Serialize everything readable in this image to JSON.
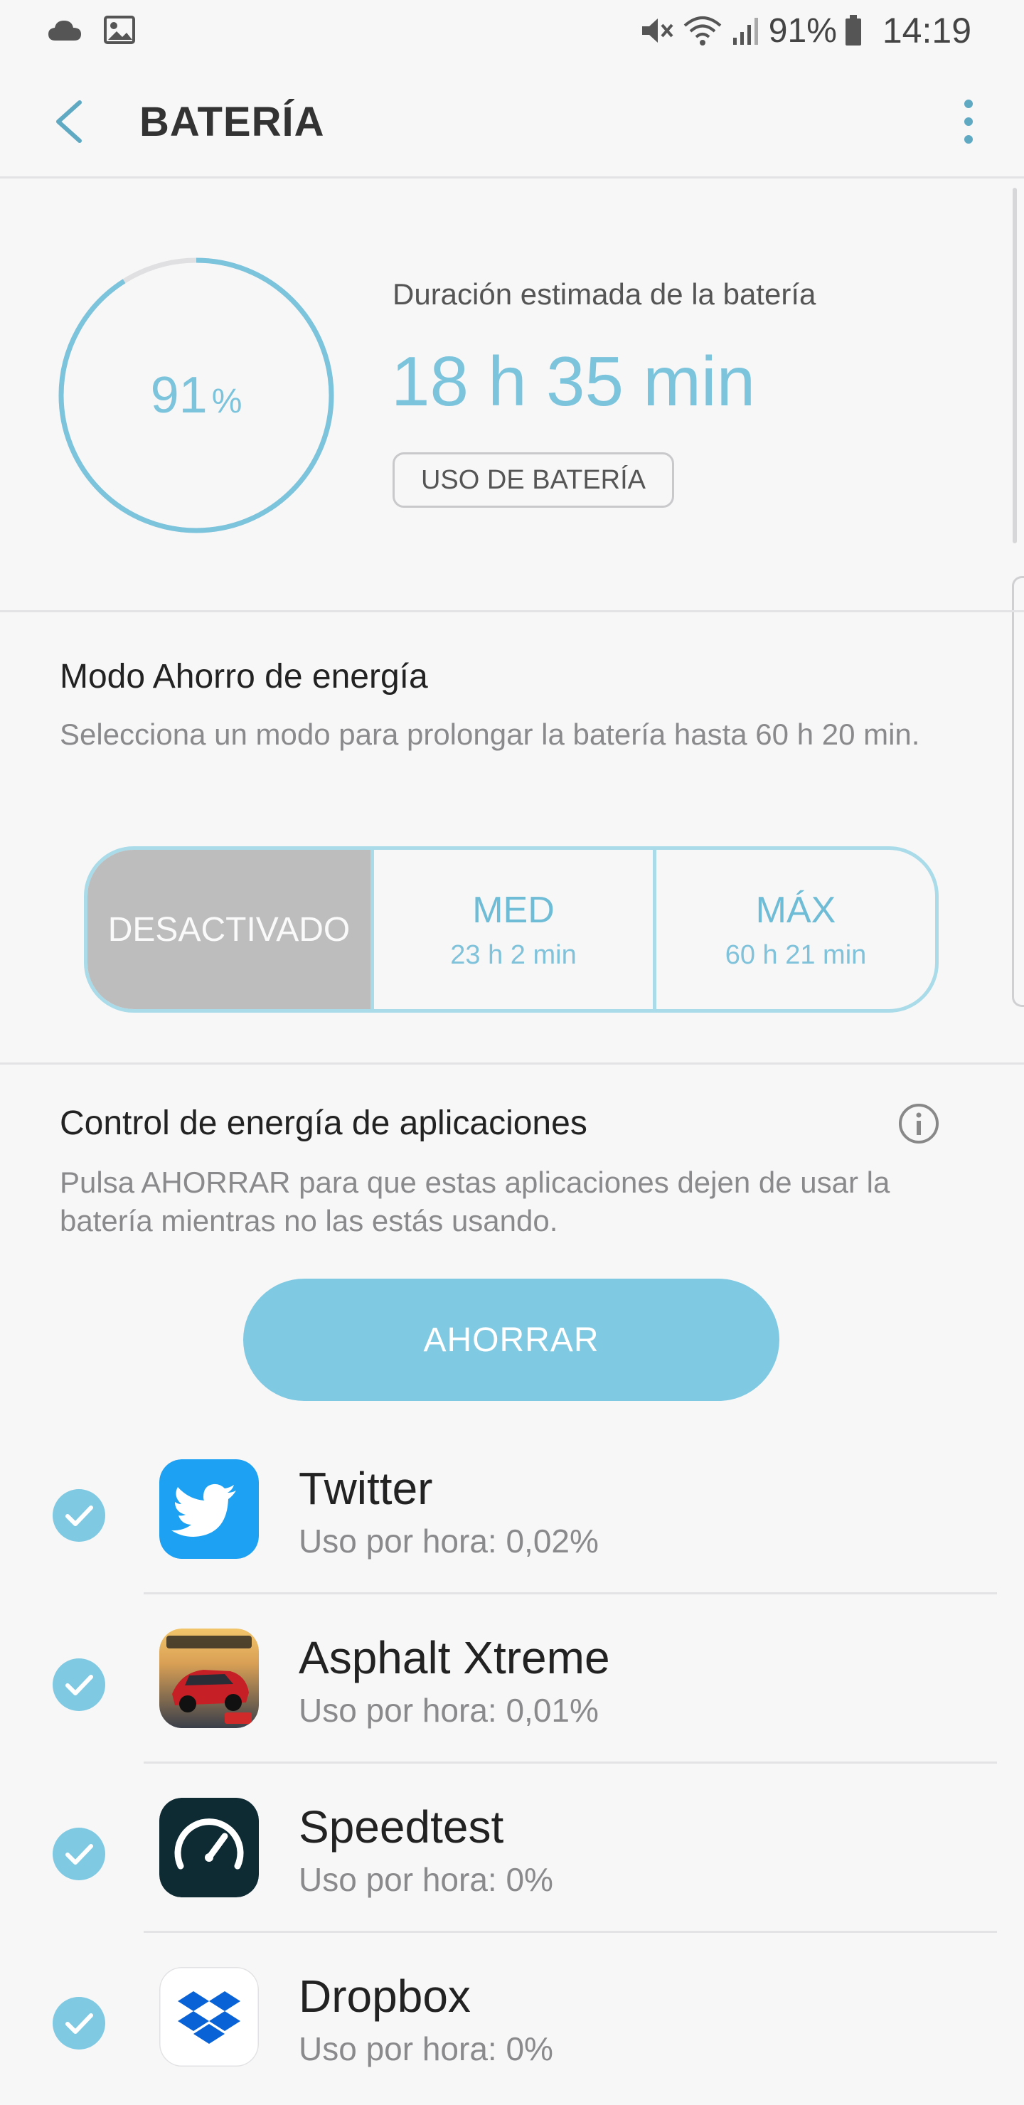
{
  "status_bar": {
    "battery_percent": "91%",
    "time": "14:19",
    "icons": [
      "cloud-icon",
      "image-icon",
      "mute-icon",
      "wifi-icon",
      "signal-icon",
      "battery-icon"
    ]
  },
  "header": {
    "title": "BATERÍA"
  },
  "battery": {
    "percent_value": "91",
    "percent_unit": "%",
    "level": 0.91,
    "estimate_label": "Duración estimada de la batería",
    "estimate_value": "18 h 35 min",
    "usage_button": "USO DE BATERÍA"
  },
  "power_saving": {
    "title": "Modo Ahorro de energía",
    "description": "Selecciona un modo para prolongar la batería hasta 60 h 20 min.",
    "modes": [
      {
        "name": "DESACTIVADO",
        "time": "",
        "selected": true
      },
      {
        "name": "MED",
        "time": "23 h 2 min",
        "selected": false
      },
      {
        "name": "MÁX",
        "time": "60 h 21 min",
        "selected": false
      }
    ]
  },
  "app_power": {
    "title": "Control de energía de aplicaciones",
    "description": "Pulsa AHORRAR para que estas aplicaciones dejen de usar la batería mientras no las estás usando.",
    "save_button": "AHORRAR",
    "apps": [
      {
        "name": "Twitter",
        "usage": "Uso por hora: 0,02%",
        "icon": "twitter-icon",
        "checked": true
      },
      {
        "name": "Asphalt Xtreme",
        "usage": "Uso por hora: 0,01%",
        "icon": "asphalt-icon",
        "checked": true
      },
      {
        "name": "Speedtest",
        "usage": "Uso por hora: 0%",
        "icon": "speedtest-icon",
        "checked": true
      },
      {
        "name": "Dropbox",
        "usage": "Uso por hora: 0%",
        "icon": "dropbox-icon",
        "checked": true
      }
    ]
  },
  "colors": {
    "accent": "#7cc3dc",
    "button": "#7fc9e2",
    "selected_mode": "#bdbdbe"
  }
}
